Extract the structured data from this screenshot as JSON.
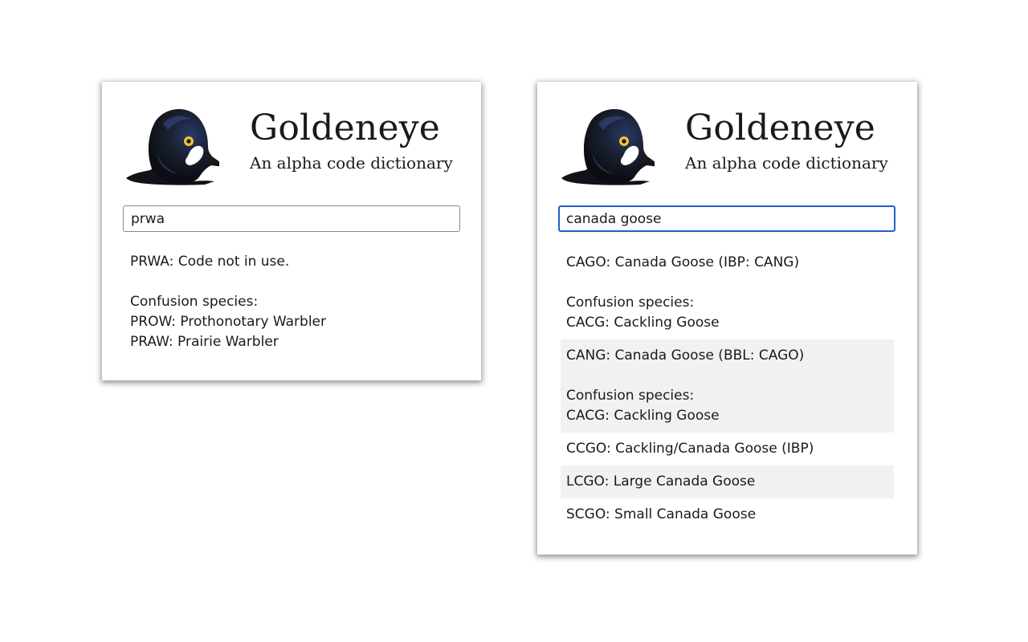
{
  "app": {
    "title": "Goldeneye",
    "subtitle": "An alpha code dictionary"
  },
  "panels": [
    {
      "search": {
        "value": "prwa",
        "focused": false
      },
      "results": [
        {
          "heading": "PRWA: Code not in use.",
          "confusion_label": "Confusion species:",
          "confusion": [
            "PROW: Prothonotary Warbler",
            "PRAW: Prairie Warbler"
          ]
        }
      ]
    },
    {
      "search": {
        "value": "canada goose",
        "focused": true
      },
      "results": [
        {
          "heading": "CAGO: Canada Goose (IBP: CANG)",
          "confusion_label": "Confusion species:",
          "confusion": [
            "CACG: Cackling Goose"
          ]
        },
        {
          "heading": "CANG: Canada Goose (BBL: CAGO)",
          "confusion_label": "Confusion species:",
          "confusion": [
            "CACG: Cackling Goose"
          ]
        },
        {
          "heading": "CCGO: Cackling/Canada Goose (IBP)"
        },
        {
          "heading": "LCGO: Large Canada Goose"
        },
        {
          "heading": "SCGO: Small Canada Goose"
        }
      ]
    }
  ],
  "colors": {
    "focus_border": "#1f63c6",
    "shaded_row": "#f1f1f1",
    "bird_head": "#1b2233",
    "bird_eye": "#f1c232",
    "bird_cheek_patch": "#ffffff"
  },
  "icons": {
    "logo": "goldeneye-bird-head-logo"
  }
}
